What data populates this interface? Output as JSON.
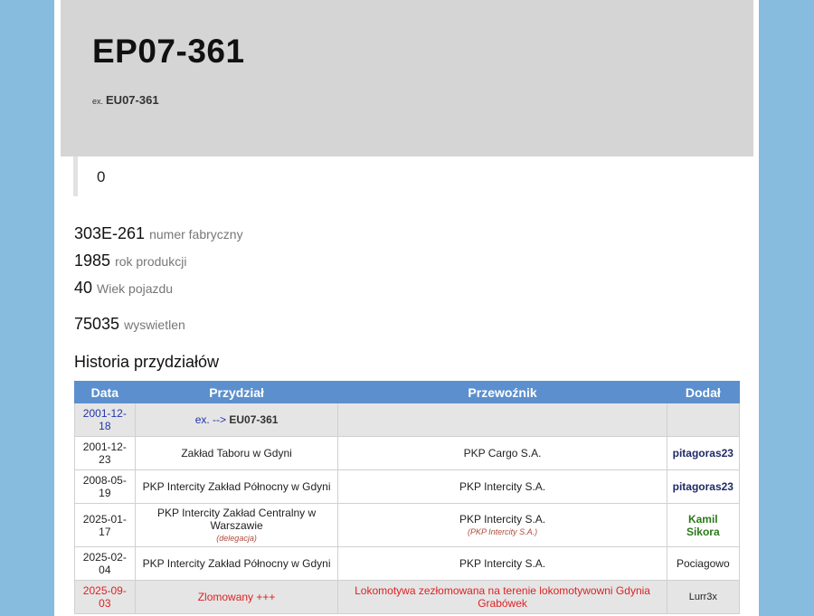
{
  "header": {
    "title": "EP07-361",
    "ex_prefix": "ex.",
    "ex_code": "EU07-361"
  },
  "quote_value": "0",
  "stats": [
    {
      "value": "303E-261",
      "label": "numer fabryczny"
    },
    {
      "value": "1985",
      "label": "rok produkcji"
    },
    {
      "value": "40",
      "label": "Wiek pojazdu"
    },
    {
      "value": "75035",
      "label": "wyswietlen"
    }
  ],
  "history": {
    "title": "Historia przydziałów",
    "columns": [
      "Data",
      "Przydział",
      "Przewoźnik",
      "Dodał"
    ],
    "rows": [
      {
        "date": "2001-12-18",
        "assign_prefix": "ex. -->",
        "assign_code": "EU07-361",
        "carrier": "",
        "carrier_note": "",
        "assign_note": "",
        "user": ""
      },
      {
        "date": "2001-12-23",
        "assignment": "Zakład Taboru w Gdyni",
        "carrier": "PKP Cargo S.A.",
        "user": "pitagoras23"
      },
      {
        "date": "2008-05-19",
        "assignment": "PKP Intercity Zakład Północny w Gdyni",
        "carrier": "PKP Intercity S.A.",
        "user": "pitagoras23"
      },
      {
        "date": "2025-01-17",
        "assignment": "PKP Intercity Zakład Centralny w Warszawie",
        "assign_note": "(delegacja)",
        "carrier": "PKP Intercity S.A.",
        "carrier_note": "(PKP Intercity S.A.)",
        "user": "Kamil Sikora"
      },
      {
        "date": "2025-02-04",
        "assignment": "PKP Intercity Zakład Północny w Gdyni",
        "carrier": "PKP Intercity S.A.",
        "user": "Pociagowo"
      },
      {
        "date": "2025-09-03",
        "assignment": "Zlomowany +++",
        "carrier": "Lokomotywa zezłomowana na terenie lokomotywowni Gdynia Grabówek",
        "user": "Lurr3x"
      }
    ]
  }
}
